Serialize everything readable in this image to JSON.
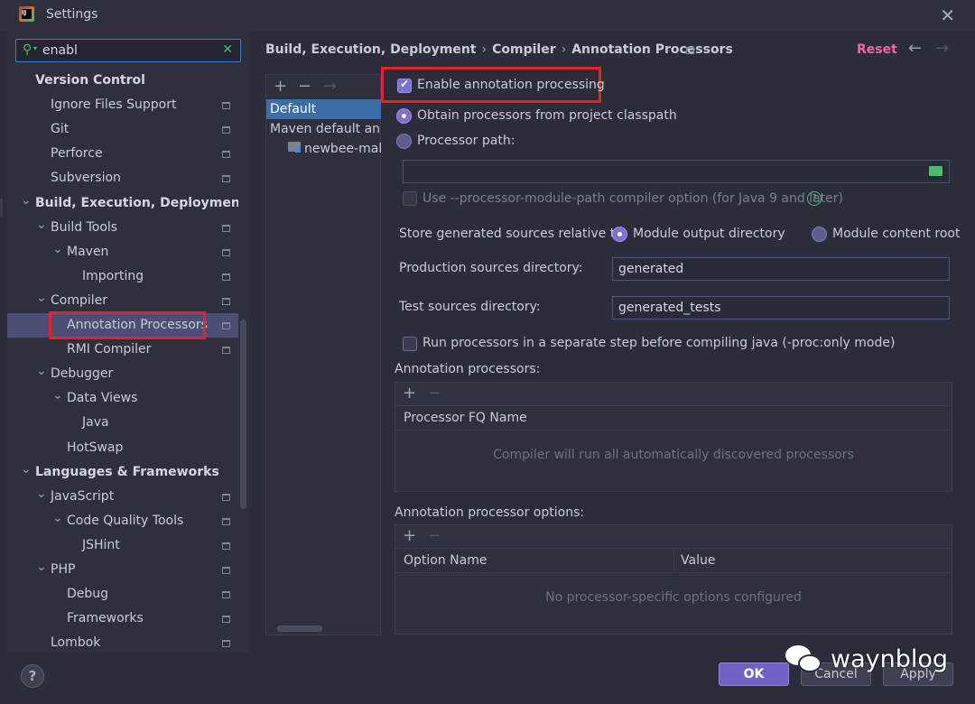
{
  "window": {
    "title": "Settings"
  },
  "search": {
    "value": "enabl"
  },
  "tree": [
    {
      "label": "Version Control",
      "bold": true,
      "level": 0,
      "expanded": null,
      "proj": false,
      "selected": false
    },
    {
      "label": "Ignore Files Support",
      "bold": false,
      "level": 1,
      "expanded": null,
      "proj": true,
      "selected": false
    },
    {
      "label": "Git",
      "bold": false,
      "level": 1,
      "expanded": null,
      "proj": true,
      "selected": false
    },
    {
      "label": "Perforce",
      "bold": false,
      "level": 1,
      "expanded": null,
      "proj": true,
      "selected": false
    },
    {
      "label": "Subversion",
      "bold": false,
      "level": 1,
      "expanded": null,
      "proj": true,
      "selected": false
    },
    {
      "label": "Build, Execution, Deployment",
      "bold": true,
      "level": 0,
      "expanded": true,
      "proj": false,
      "selected": false
    },
    {
      "label": "Build Tools",
      "bold": false,
      "level": 1,
      "expanded": true,
      "proj": true,
      "selected": false
    },
    {
      "label": "Maven",
      "bold": false,
      "level": 2,
      "expanded": true,
      "proj": true,
      "selected": false
    },
    {
      "label": "Importing",
      "bold": false,
      "level": 3,
      "expanded": null,
      "proj": true,
      "selected": false
    },
    {
      "label": "Compiler",
      "bold": false,
      "level": 1,
      "expanded": true,
      "proj": true,
      "selected": false
    },
    {
      "label": "Annotation Processors",
      "bold": false,
      "level": 2,
      "expanded": null,
      "proj": true,
      "selected": true
    },
    {
      "label": "RMI Compiler",
      "bold": false,
      "level": 2,
      "expanded": null,
      "proj": true,
      "selected": false
    },
    {
      "label": "Debugger",
      "bold": false,
      "level": 1,
      "expanded": true,
      "proj": false,
      "selected": false
    },
    {
      "label": "Data Views",
      "bold": false,
      "level": 2,
      "expanded": true,
      "proj": false,
      "selected": false
    },
    {
      "label": "Java",
      "bold": false,
      "level": 3,
      "expanded": null,
      "proj": false,
      "selected": false
    },
    {
      "label": "HotSwap",
      "bold": false,
      "level": 2,
      "expanded": null,
      "proj": false,
      "selected": false
    },
    {
      "label": "Languages & Frameworks",
      "bold": true,
      "level": 0,
      "expanded": true,
      "proj": false,
      "selected": false
    },
    {
      "label": "JavaScript",
      "bold": false,
      "level": 1,
      "expanded": true,
      "proj": true,
      "selected": false
    },
    {
      "label": "Code Quality Tools",
      "bold": false,
      "level": 2,
      "expanded": true,
      "proj": true,
      "selected": false
    },
    {
      "label": "JSHint",
      "bold": false,
      "level": 3,
      "expanded": null,
      "proj": true,
      "selected": false
    },
    {
      "label": "PHP",
      "bold": false,
      "level": 1,
      "expanded": true,
      "proj": true,
      "selected": false
    },
    {
      "label": "Debug",
      "bold": false,
      "level": 2,
      "expanded": null,
      "proj": true,
      "selected": false
    },
    {
      "label": "Frameworks",
      "bold": false,
      "level": 2,
      "expanded": null,
      "proj": true,
      "selected": false
    },
    {
      "label": "Lombok",
      "bold": false,
      "level": 1,
      "expanded": null,
      "proj": true,
      "selected": false
    }
  ],
  "profiles": {
    "add": "+",
    "remove": "−",
    "copy": "→",
    "items": [
      "Default",
      "Maven default annotation processors profile",
      "newbee-mall-plus"
    ]
  },
  "breadcrumb": {
    "parts": [
      "Build, Execution, Deployment",
      "Compiler",
      "Annotation Processors"
    ],
    "separator": "›"
  },
  "header": {
    "reset": "Reset",
    "back": "←",
    "forward": "→"
  },
  "options": {
    "enable": "Enable annotation processing",
    "classpath": "Obtain processors from project classpath",
    "processor_path": "Processor path:",
    "module_path": "Use --processor-module-path compiler option (for Java 9 and later)",
    "help_glyph": "?",
    "store_label": "Store generated sources relative to:",
    "store_output": "Module output directory",
    "store_content": "Module content root",
    "prod_label": "Production sources directory:",
    "prod_value": "generated",
    "test_label": "Test sources directory:",
    "test_value": "generated_tests",
    "separate_step": "Run processors in a separate step before compiling java (-proc:only mode)"
  },
  "processors_table": {
    "title": "Annotation processors:",
    "add": "+",
    "remove": "−",
    "column": "Processor FQ Name",
    "empty": "Compiler will run all automatically discovered processors"
  },
  "options_table": {
    "title": "Annotation processor options:",
    "add": "+",
    "remove": "−",
    "col_name": "Option Name",
    "col_value": "Value",
    "empty": "No processor-specific options configured"
  },
  "buttons": {
    "help": "?",
    "ok": "OK",
    "cancel": "Cancel",
    "apply": "Apply"
  },
  "watermark": {
    "text": "waynblog"
  },
  "colors": {
    "accent": "#7e70d0",
    "selection": "#4b4f73",
    "reset": "#ff5fa9",
    "highlight_box": "#e5212b"
  }
}
